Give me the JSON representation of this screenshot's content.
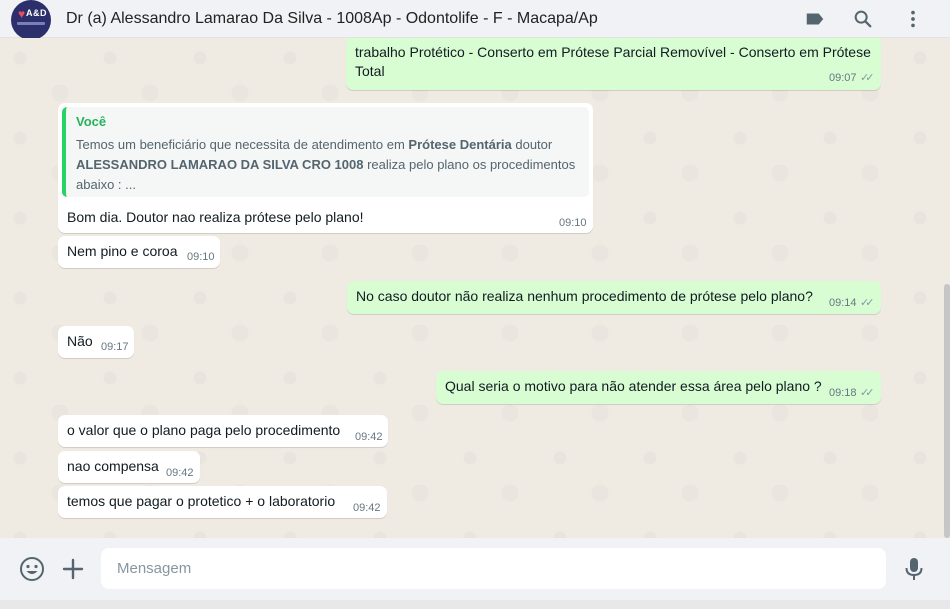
{
  "header": {
    "title": "Dr (a) Alessandro Lamarao Da Silva - 1008Ap - Odontolife - F - Macapa/Ap",
    "avatar_text": "A&D",
    "icons": [
      "label-icon",
      "search-icon",
      "more-vertical-icon"
    ]
  },
  "messages": [
    {
      "dir": "out",
      "text": "trabalho Protético  - Conserto em Prótese Parcial Removível - Conserto em Prótese Total",
      "time": "09:07",
      "ticks": "✓✓"
    },
    {
      "dir": "in",
      "quote_author": "Você",
      "quote_text_1": "Temos um beneficiário que necessita de atendimento em ",
      "quote_bold_1": "Prótese Dentária",
      "quote_text_2": " doutor ",
      "quote_bold_2": "ALESSANDRO LAMARAO DA SILVA  CRO 1008",
      "quote_text_3": " realiza pelo plano os procedimentos abaixo : ...",
      "text": "Bom dia. Doutor nao realiza prótese pelo plano!",
      "time": "09:10"
    },
    {
      "dir": "in",
      "text": "Nem pino e coroa",
      "time": "09:10"
    },
    {
      "dir": "out",
      "text": "No caso doutor não realiza nenhum procedimento de prótese pelo plano?",
      "time": "09:14",
      "ticks": "✓✓"
    },
    {
      "dir": "in",
      "text": "Não",
      "time": "09:17"
    },
    {
      "dir": "out",
      "text": "Qual seria o motivo para não atender essa área pelo plano ?",
      "time": "09:18",
      "ticks": "✓✓"
    },
    {
      "dir": "in",
      "text": "o valor que o plano paga pelo procedimento",
      "time": "09:42"
    },
    {
      "dir": "in",
      "text": "nao compensa",
      "time": "09:42"
    },
    {
      "dir": "in",
      "text": "temos que pagar o protetico + o laboratorio",
      "time": "09:42"
    }
  ],
  "footer": {
    "placeholder": "Mensagem",
    "icons": [
      "emoji-icon",
      "attach-plus-icon",
      "microphone-icon"
    ]
  },
  "colors": {
    "outgoing_bubble": "#d9fdd3",
    "incoming_bubble": "#ffffff",
    "quote_accent": "#25d366",
    "chat_background": "#efeae2"
  }
}
